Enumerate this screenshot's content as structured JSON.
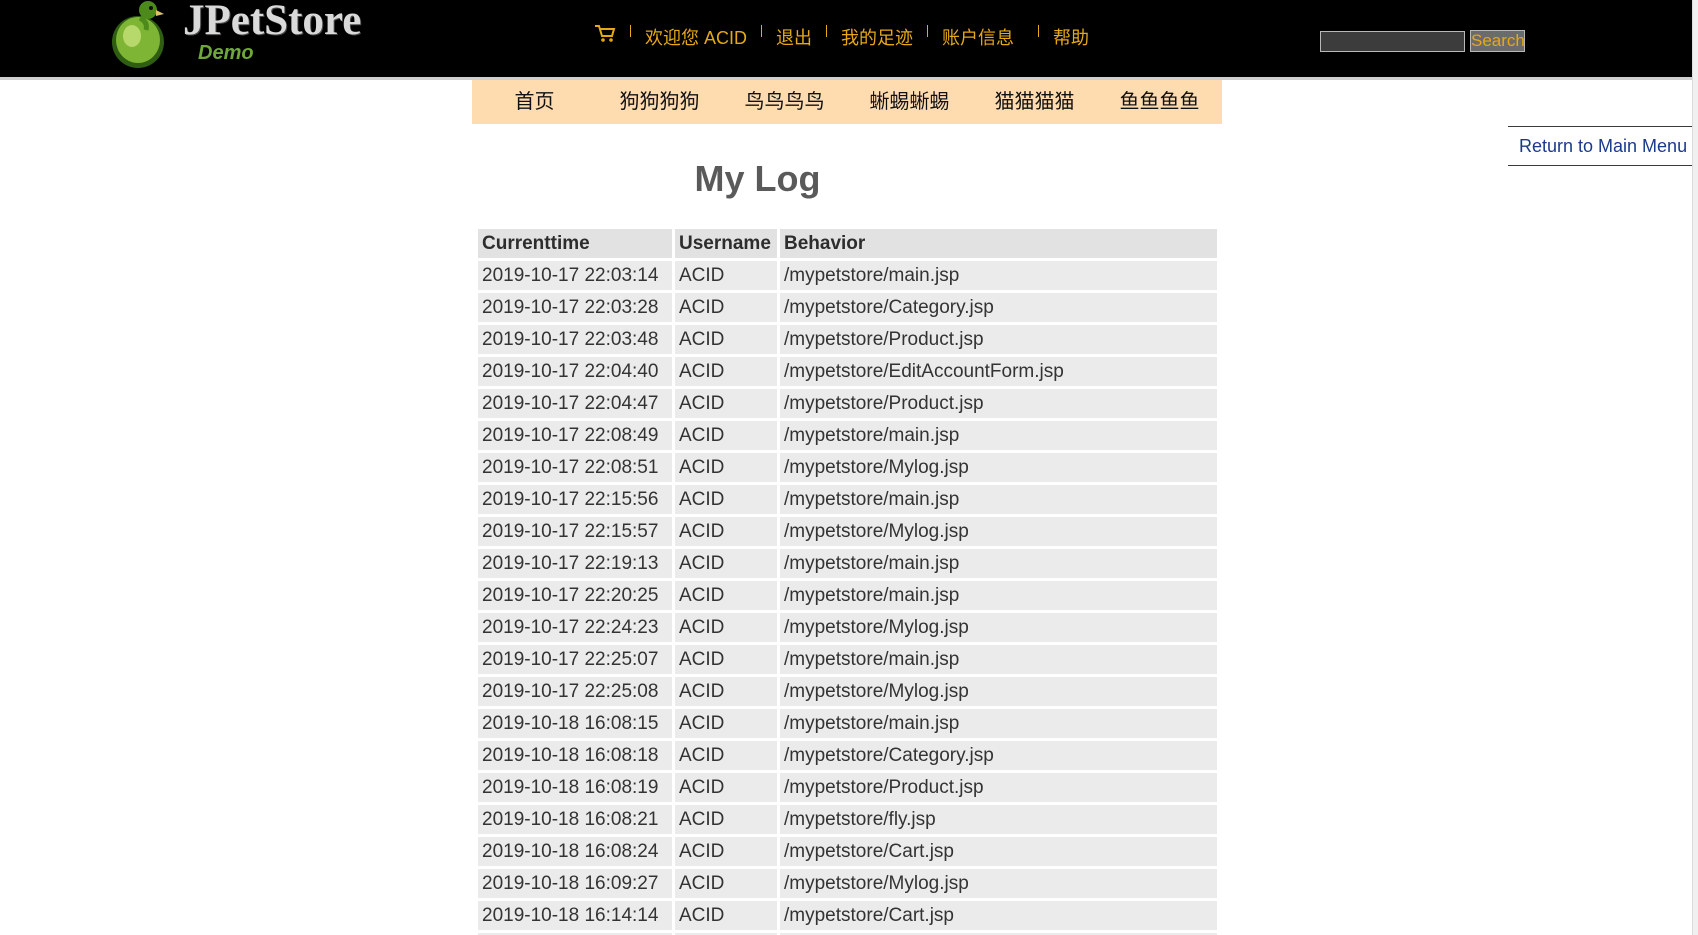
{
  "header": {
    "logo_text": "JPetStore",
    "logo_sub": "Demo",
    "menu": {
      "welcome": "欢迎您 ACID",
      "logout": "退出",
      "footprint": "我的足迹",
      "account": "账户信息",
      "help": "帮助"
    },
    "search": {
      "value": "",
      "button_label": "Search"
    }
  },
  "categories": [
    {
      "label": "首页"
    },
    {
      "label": "狗狗狗狗"
    },
    {
      "label": "鸟鸟鸟鸟"
    },
    {
      "label": "蜥蜴蜥蜴"
    },
    {
      "label": "猫猫猫猫"
    },
    {
      "label": "鱼鱼鱼鱼"
    }
  ],
  "side_menu": {
    "return_label": "Return to Main Menu"
  },
  "title": "My Log",
  "table": {
    "headers": {
      "time": "Currenttime",
      "user": "Username",
      "behavior": "Behavior"
    },
    "rows": [
      {
        "time": "2019-10-17 22:03:14",
        "user": "ACID",
        "behavior": "/mypetstore/main.jsp"
      },
      {
        "time": "2019-10-17 22:03:28",
        "user": "ACID",
        "behavior": "/mypetstore/Category.jsp"
      },
      {
        "time": "2019-10-17 22:03:48",
        "user": "ACID",
        "behavior": "/mypetstore/Product.jsp"
      },
      {
        "time": "2019-10-17 22:04:40",
        "user": "ACID",
        "behavior": "/mypetstore/EditAccountForm.jsp"
      },
      {
        "time": "2019-10-17 22:04:47",
        "user": "ACID",
        "behavior": "/mypetstore/Product.jsp"
      },
      {
        "time": "2019-10-17 22:08:49",
        "user": "ACID",
        "behavior": "/mypetstore/main.jsp"
      },
      {
        "time": "2019-10-17 22:08:51",
        "user": "ACID",
        "behavior": "/mypetstore/Mylog.jsp"
      },
      {
        "time": "2019-10-17 22:15:56",
        "user": "ACID",
        "behavior": "/mypetstore/main.jsp"
      },
      {
        "time": "2019-10-17 22:15:57",
        "user": "ACID",
        "behavior": "/mypetstore/Mylog.jsp"
      },
      {
        "time": "2019-10-17 22:19:13",
        "user": "ACID",
        "behavior": "/mypetstore/main.jsp"
      },
      {
        "time": "2019-10-17 22:20:25",
        "user": "ACID",
        "behavior": "/mypetstore/main.jsp"
      },
      {
        "time": "2019-10-17 22:24:23",
        "user": "ACID",
        "behavior": "/mypetstore/Mylog.jsp"
      },
      {
        "time": "2019-10-17 22:25:07",
        "user": "ACID",
        "behavior": "/mypetstore/main.jsp"
      },
      {
        "time": "2019-10-17 22:25:08",
        "user": "ACID",
        "behavior": "/mypetstore/Mylog.jsp"
      },
      {
        "time": "2019-10-18 16:08:15",
        "user": "ACID",
        "behavior": "/mypetstore/main.jsp"
      },
      {
        "time": "2019-10-18 16:08:18",
        "user": "ACID",
        "behavior": "/mypetstore/Category.jsp"
      },
      {
        "time": "2019-10-18 16:08:19",
        "user": "ACID",
        "behavior": "/mypetstore/Product.jsp"
      },
      {
        "time": "2019-10-18 16:08:21",
        "user": "ACID",
        "behavior": "/mypetstore/fly.jsp"
      },
      {
        "time": "2019-10-18 16:08:24",
        "user": "ACID",
        "behavior": "/mypetstore/Cart.jsp"
      },
      {
        "time": "2019-10-18 16:09:27",
        "user": "ACID",
        "behavior": "/mypetstore/Mylog.jsp"
      },
      {
        "time": "2019-10-18 16:14:14",
        "user": "ACID",
        "behavior": "/mypetstore/Cart.jsp"
      },
      {
        "time": "",
        "user": "",
        "behavior": ""
      }
    ]
  },
  "icons": {
    "cart": "cart-icon",
    "logo": "parrot-logo"
  },
  "colors": {
    "header_bg": "#000000",
    "menu_text": "#e6a817",
    "category_bar": "#ffdcb0",
    "link": "#1a3a8c",
    "title": "#5a5a5a",
    "row_bg": "#ebebeb"
  }
}
